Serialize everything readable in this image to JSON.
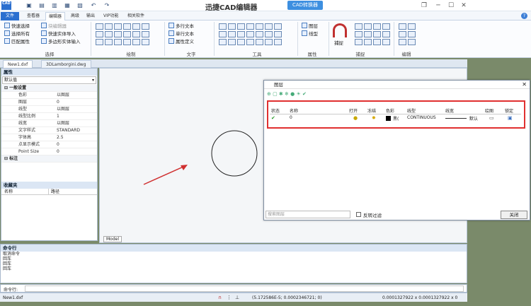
{
  "window": {
    "title": "迅捷CAD编辑器",
    "badge": "CAD转换器",
    "logo": "CAD",
    "help": "?"
  },
  "ribbon_tabs": [
    "文件",
    "查看器",
    "编辑器",
    "高级",
    "输出",
    "VIP功能",
    "相关软件"
  ],
  "ribbon": {
    "select": {
      "items": [
        "快速选择",
        "选择所有",
        "匹配属性"
      ],
      "label": "选择"
    },
    "block": {
      "items": [
        "块编辑器",
        "快速实体导入",
        "多边形实体输入"
      ]
    },
    "draw": {
      "label": "绘制"
    },
    "text": {
      "items": [
        "多行文本",
        "单行文本",
        "属性定义"
      ],
      "label": "文字"
    },
    "tools": {
      "label": "工具"
    },
    "layers": {
      "items": [
        "图层",
        "线型"
      ],
      "label": "属性"
    },
    "snap": {
      "capture": "捕捉",
      "label": "捕捉"
    },
    "edit": {
      "label": "编辑"
    }
  },
  "doc_tabs": [
    "New1.dxf",
    "3DLamborgini.dwg"
  ],
  "props": {
    "title": "属性",
    "default": "默认值",
    "section1": "一般设置",
    "rows": [
      {
        "k": "色彩",
        "v": "以图层"
      },
      {
        "k": "图层",
        "v": "0"
      },
      {
        "k": "线型",
        "v": "以图层"
      },
      {
        "k": "线型比例",
        "v": "1"
      },
      {
        "k": "线宽",
        "v": "以图层"
      },
      {
        "k": "文字样式",
        "v": "STANDARD"
      },
      {
        "k": "字体高",
        "v": "2.5"
      },
      {
        "k": "点显示模式",
        "v": "0"
      },
      {
        "k": "Point Size",
        "v": "0"
      }
    ],
    "section2": "标注"
  },
  "favorites": {
    "title": "收藏夹",
    "col_name": "名称",
    "col_path": "路径"
  },
  "canvas": {
    "model_tab": "Model"
  },
  "layer_dialog": {
    "title": "图层",
    "headers": [
      "状态",
      "名称",
      "打开",
      "冻结",
      "色彩",
      "线型",
      "线宽",
      "绘图",
      "锁定"
    ],
    "row": {
      "name": "0",
      "color": "黑(",
      "linetype": "CONTINUOUS",
      "lineweight": "默认"
    },
    "search_placeholder": "搜索图层",
    "reverse": "反转过滤",
    "close": "关闭"
  },
  "command": {
    "title": "命令行",
    "lines": [
      "取消命令",
      "回车",
      "回车",
      "回车"
    ],
    "label": "命令行:"
  },
  "status": {
    "file": "New1.dxf",
    "coords": "(5.172586E-5; 0.0002346721; 0)",
    "size": "0.0001327922 x 0.0001327922 x 0"
  }
}
